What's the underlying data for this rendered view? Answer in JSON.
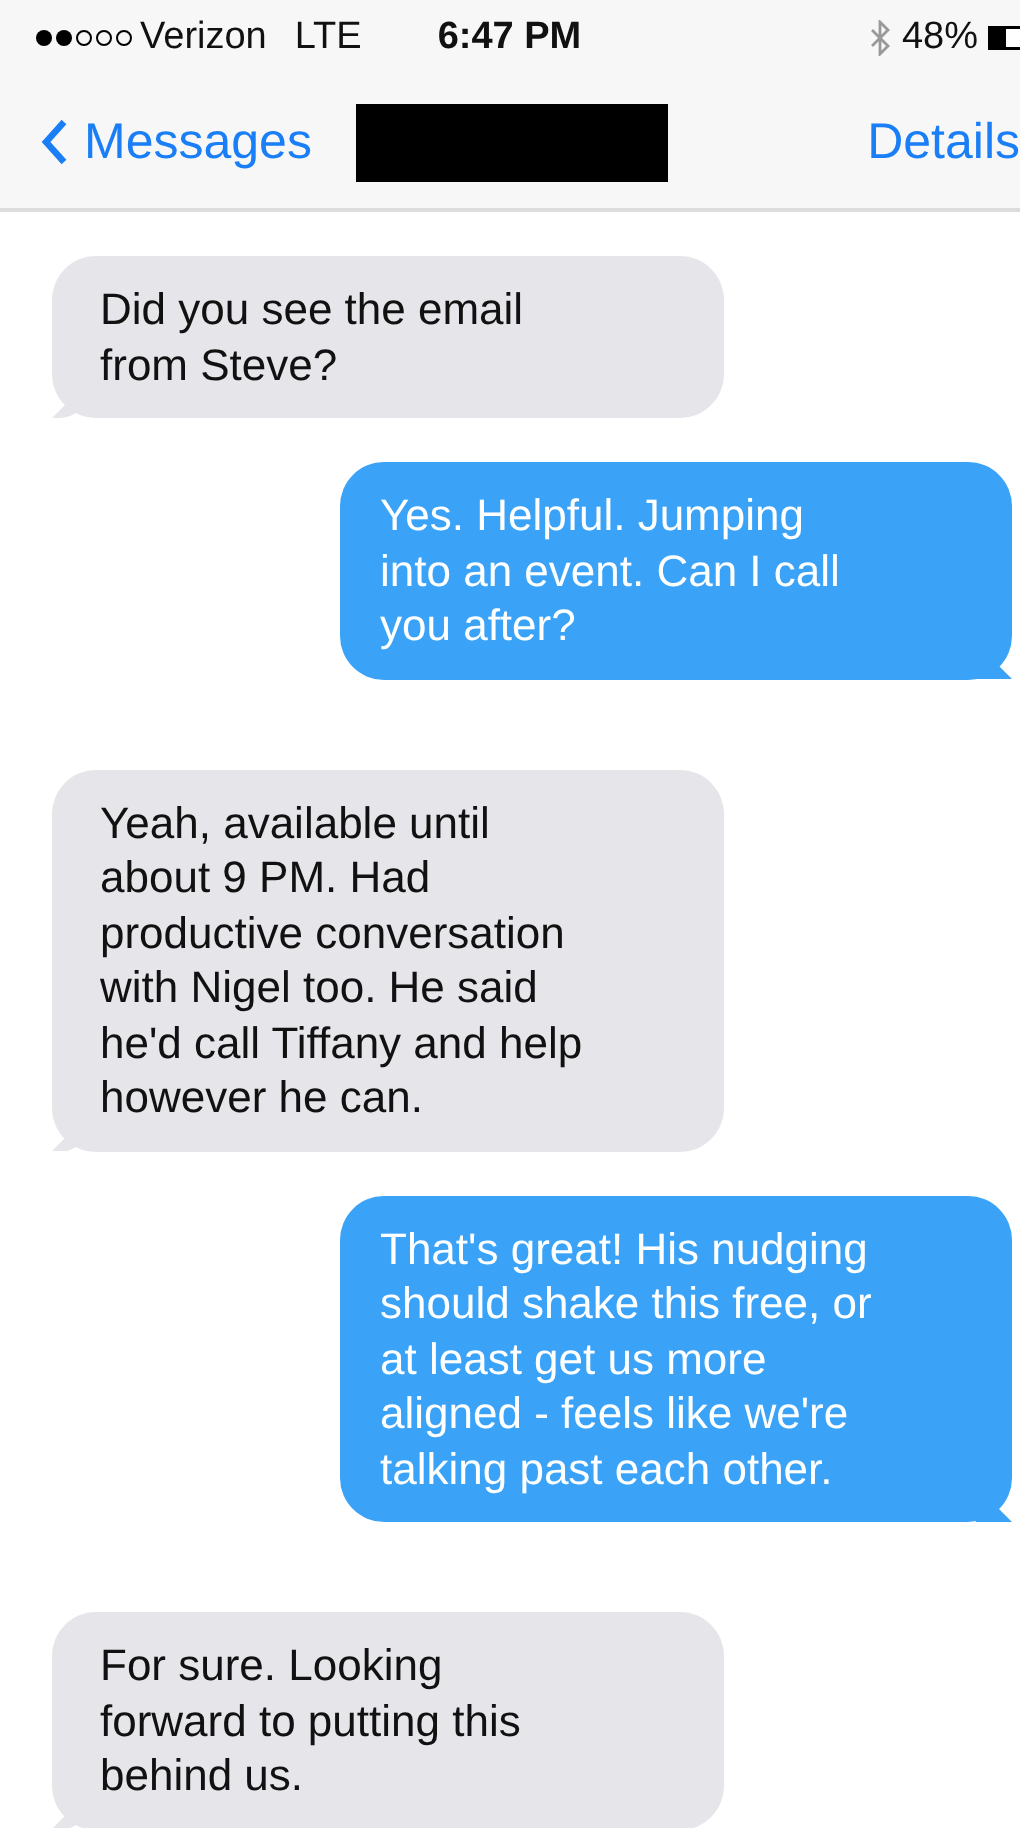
{
  "status_bar": {
    "carrier": "Verizon",
    "network": "LTE",
    "time": "6:47 PM",
    "battery": "48%"
  },
  "nav_bar": {
    "back": "Messages",
    "action": "Details"
  },
  "messages": [
    {
      "kind": "received",
      "text": "Did you see the email\nfrom Steve?"
    },
    {
      "kind": "sent",
      "text": "Yes. Helpful. Jumping\ninto an event. Can I call\nyou after?"
    },
    {
      "kind": "received",
      "text": "Yeah, available until\nabout 9 PM. Had\nproductive conversation\nwith Nigel too. He said\nhe'd call Tiffany and help\nhowever he can."
    },
    {
      "kind": "sent",
      "text": "That's great! His nudging\nshould shake this free, or\nat least get us more\naligned - feels like we're\ntalking past each other."
    },
    {
      "kind": "received",
      "text": "For sure. Looking\nforward to putting this\nbehind us."
    }
  ]
}
